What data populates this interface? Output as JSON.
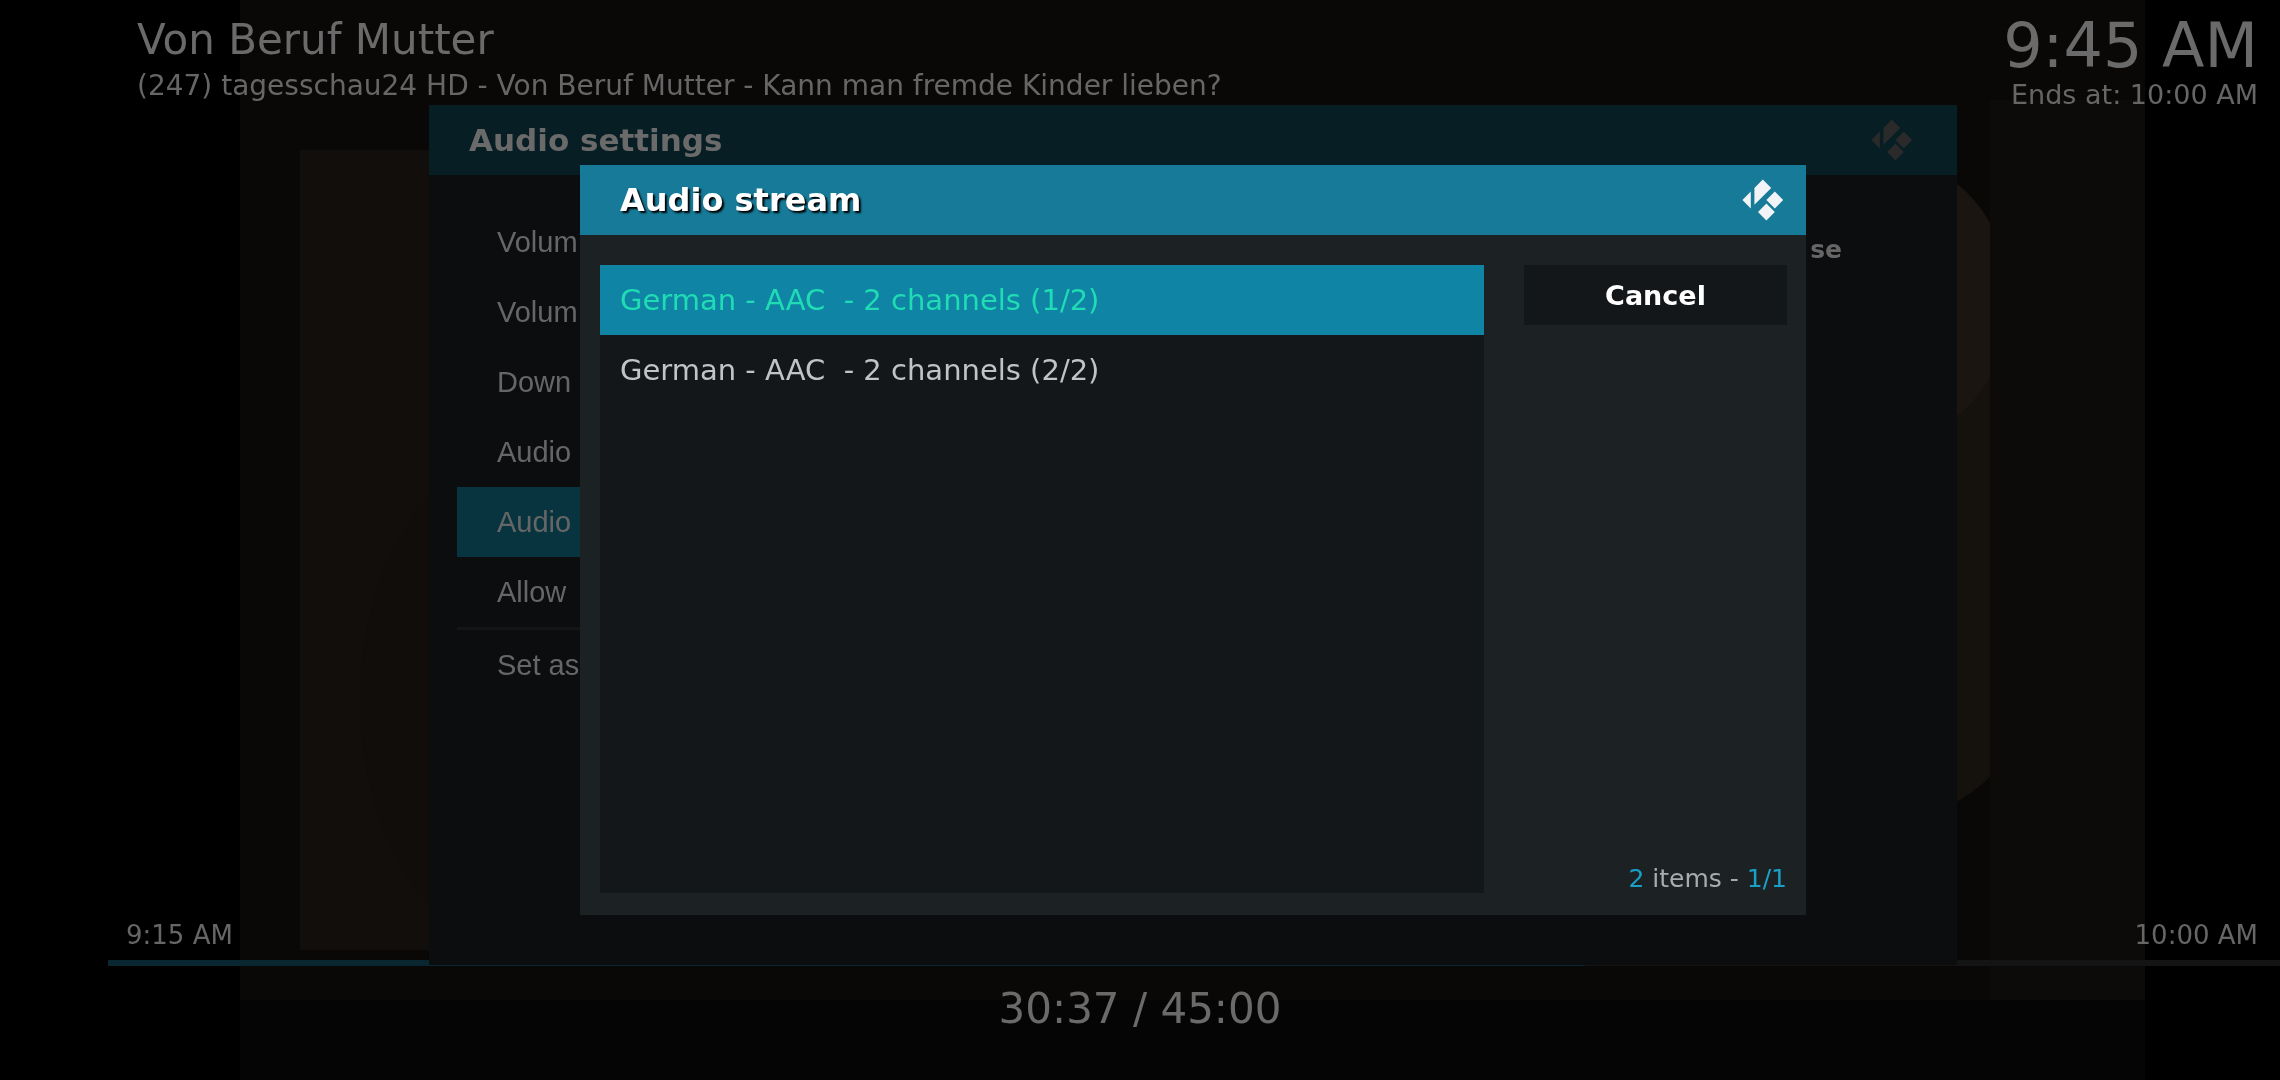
{
  "osd": {
    "title": "Von Beruf Mutter",
    "subtitle": "(247) tagesschau24 HD  - Von Beruf Mutter - Kann man fremde Kinder lieben?",
    "clock": "9:45 AM",
    "ends_at": "Ends at: 10:00 AM",
    "start_time": "9:15 AM",
    "end_time": "10:00 AM",
    "progress": {
      "level": 0.68
    },
    "elapsed": "30:37 / 45:00"
  },
  "settings": {
    "title": "Audio settings",
    "groups": [
      [
        {
          "label": "Volum",
          "selected": false
        },
        {
          "label": "Volum",
          "selected": false
        },
        {
          "label": "Down",
          "selected": false
        },
        {
          "label": "Audio",
          "selected": false
        },
        {
          "label": "Audio",
          "selected": true
        },
        {
          "label": "Allow",
          "selected": false
        }
      ],
      [
        {
          "label": "Set as",
          "selected": false
        }
      ]
    ],
    "side_text": "se"
  },
  "dialog": {
    "title": "Audio stream",
    "streams": [
      {
        "label": "German - AAC  - 2 channels (1/2)",
        "selected": true
      },
      {
        "label": "German - AAC  - 2 channels (2/2)",
        "selected": false
      }
    ],
    "buttons": [
      "Cancel"
    ],
    "count": "2",
    "count_label": "items -",
    "page": "1/1"
  }
}
